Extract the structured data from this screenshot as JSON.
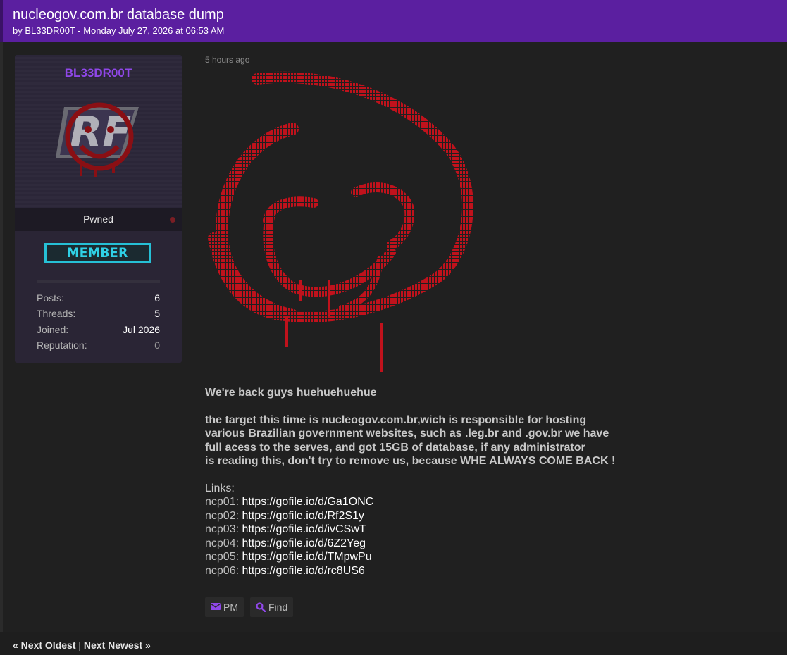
{
  "thread": {
    "title": "nucleogov.com.br database dump",
    "meta": "by BL33DR00T - Monday July 27, 2026 at 06:53 AM"
  },
  "user": {
    "name": "BL33DR00T",
    "title": "Pwned",
    "rank": "MEMBER",
    "stats": [
      {
        "label": "Posts:",
        "value": "6"
      },
      {
        "label": "Threads:",
        "value": "5"
      },
      {
        "label": "Joined:",
        "value": "Jul 2026"
      },
      {
        "label": "Reputation:",
        "value": "0"
      }
    ]
  },
  "post": {
    "time": "5 hours ago",
    "greeting": "We're back guys huehuehuehue",
    "message_lines": [
      "the target this time is nucleogov.com.br,wich is responsible for hosting",
      "various Brazilian government websites, such as .leg.br and .gov.br we have",
      "full acess to the serves, and got 15GB of database, if any administrator",
      "is reading this, don't try to remove us, because WHE ALWAYS COME BACK !"
    ],
    "links_heading": "Links:",
    "links": [
      {
        "label": "ncp01:",
        "url": "https://gofile.io/d/Ga1ONC"
      },
      {
        "label": "ncp02:",
        "url": "https://gofile.io/d/Rf2S1y"
      },
      {
        "label": "ncp03:",
        "url": "https://gofile.io/d/ivCSwT"
      },
      {
        "label": "ncp04:",
        "url": "https://gofile.io/d/6Z2Yeg"
      },
      {
        "label": "ncp05:",
        "url": "https://gofile.io/d/TMpwPu"
      },
      {
        "label": "ncp06:",
        "url": "https://gofile.io/d/rc8US6"
      }
    ]
  },
  "buttons": {
    "pm": "PM",
    "find": "Find"
  },
  "nav": {
    "prev": "« Next Oldest",
    "sep": "|",
    "next": "Next Newest »"
  },
  "colors": {
    "header": "#5b1fa0",
    "username": "#8f47e8",
    "rank": "#2fd0e6",
    "art": "#c0121c",
    "icon": "#8f47e8"
  },
  "icons": {
    "pm": "envelope-icon",
    "find": "search-icon"
  }
}
